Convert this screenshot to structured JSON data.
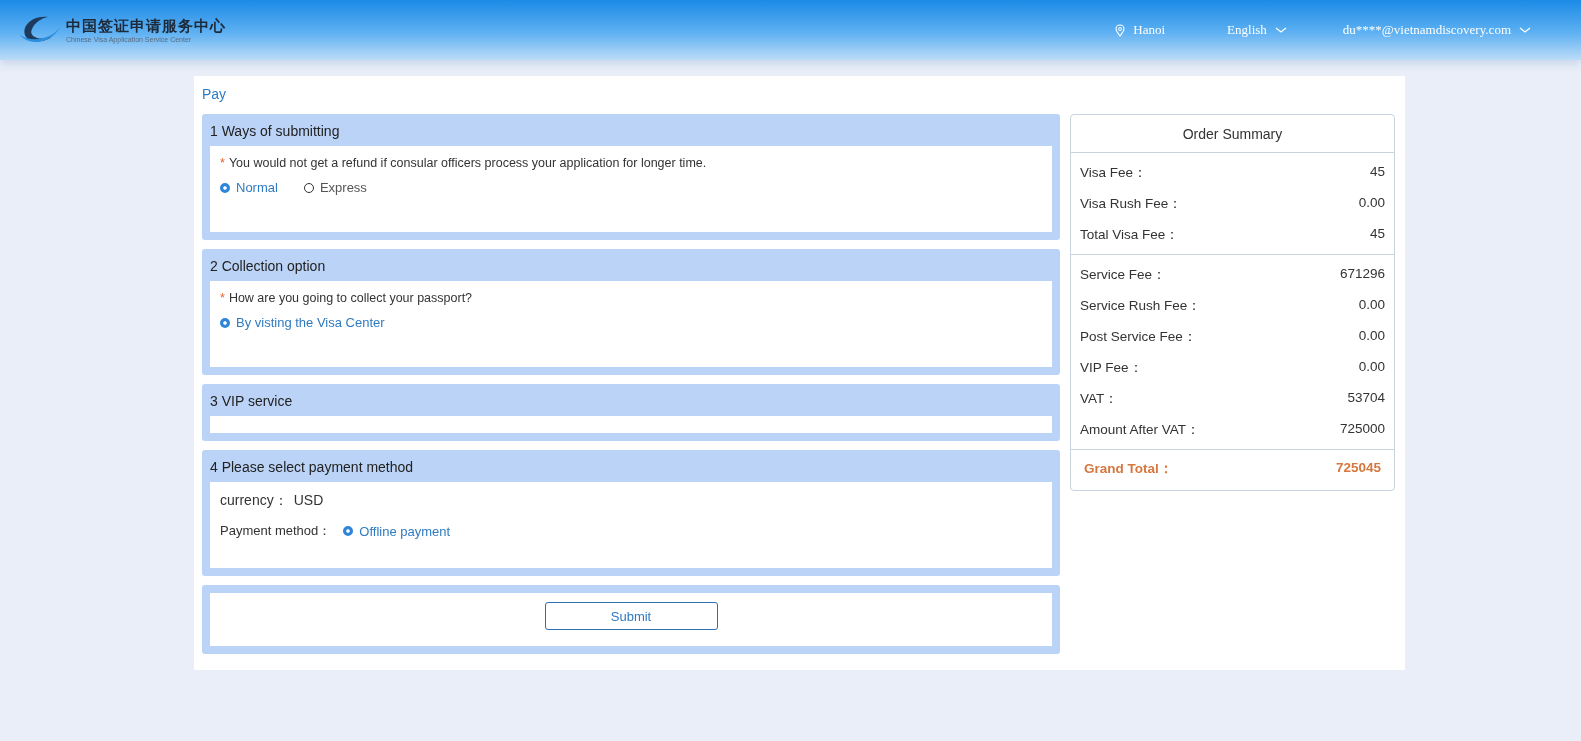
{
  "header": {
    "logo_title": "中国签证申请服务中心",
    "logo_subtitle": "Chinese Visa Application Service Center",
    "location": "Hanoi",
    "language": "English",
    "account": "du****@vietnamdiscovery.com"
  },
  "page_title": "Pay",
  "sections": [
    {
      "kind": "choice",
      "title": "1 Ways of submitting",
      "marker": "*",
      "question": "You would not get a refund if consular officers process your application for longer time.",
      "options": [
        {
          "label": "Normal",
          "selected": true
        },
        {
          "label": "Express",
          "selected": false
        }
      ]
    },
    {
      "kind": "choice",
      "title": "2 Collection option",
      "marker": "*",
      "question": "How are you going to collect your passport?",
      "options": [
        {
          "label": "By visting the Visa Center",
          "selected": true
        }
      ]
    },
    {
      "kind": "empty",
      "title": "3 VIP service"
    },
    {
      "kind": "payment",
      "title": "4 Please select payment method",
      "currency_label": "currency：",
      "currency": "USD",
      "method_label": "Payment method：",
      "options": [
        {
          "label": "Offline payment",
          "selected": true
        }
      ]
    }
  ],
  "submit": "Submit",
  "summary": {
    "title": "Order Summary",
    "groups": [
      [
        {
          "label": "Visa Fee：",
          "value": "45"
        },
        {
          "label": "Visa Rush Fee：",
          "value": "0.00"
        },
        {
          "label": "Total Visa Fee：",
          "value": "45"
        }
      ],
      [
        {
          "label": "Service Fee：",
          "value": "671296"
        },
        {
          "label": "Service Rush Fee：",
          "value": "0.00"
        },
        {
          "label": "Post Service Fee：",
          "value": "0.00"
        },
        {
          "label": "VIP Fee：",
          "value": "0.00"
        },
        {
          "label": "VAT：",
          "value": "53704"
        },
        {
          "label": "Amount After VAT：",
          "value": "725000"
        }
      ]
    ],
    "grand_total": {
      "label": "Grand Total：",
      "value": "725045"
    }
  }
}
